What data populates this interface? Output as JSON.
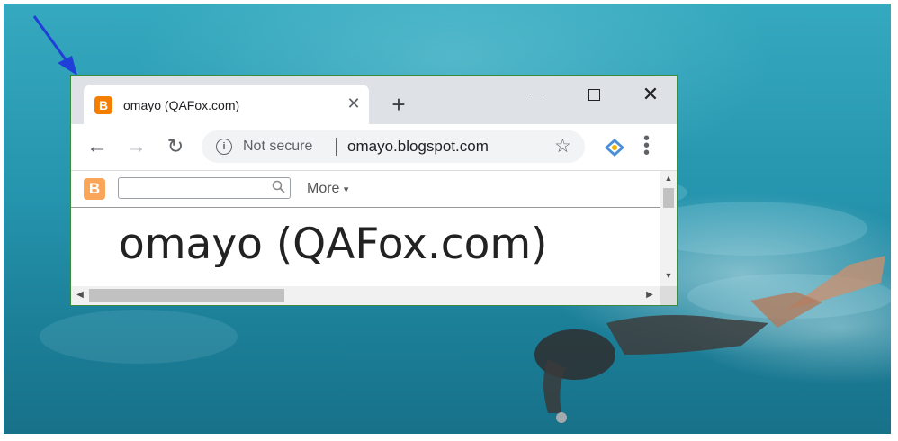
{
  "browser": {
    "tab": {
      "title": "omayo (QAFox.com)",
      "favicon": "blogger-icon",
      "close_glyph": "✕"
    },
    "new_tab_glyph": "+",
    "window_controls": {
      "close_glyph": "✕"
    },
    "toolbar": {
      "back_glyph": "←",
      "forward_glyph": "→",
      "reload_glyph": "↻",
      "security_label": "Not secure",
      "url": "omayo.blogspot.com",
      "bookmark_glyph": "☆",
      "menu_glyph": "⋮"
    }
  },
  "page": {
    "navbar": {
      "logo_letter": "B",
      "search_placeholder": "",
      "search_glyph": "🔍",
      "more_label": "More",
      "more_caret": "▾"
    },
    "blog_title": "omayo (QAFox.com)"
  },
  "colors": {
    "blogger_orange": "#f57d00",
    "desktop_water": "#2594ad",
    "arrow_blue": "#1f3fd8",
    "window_border": "#3c8a3c"
  }
}
